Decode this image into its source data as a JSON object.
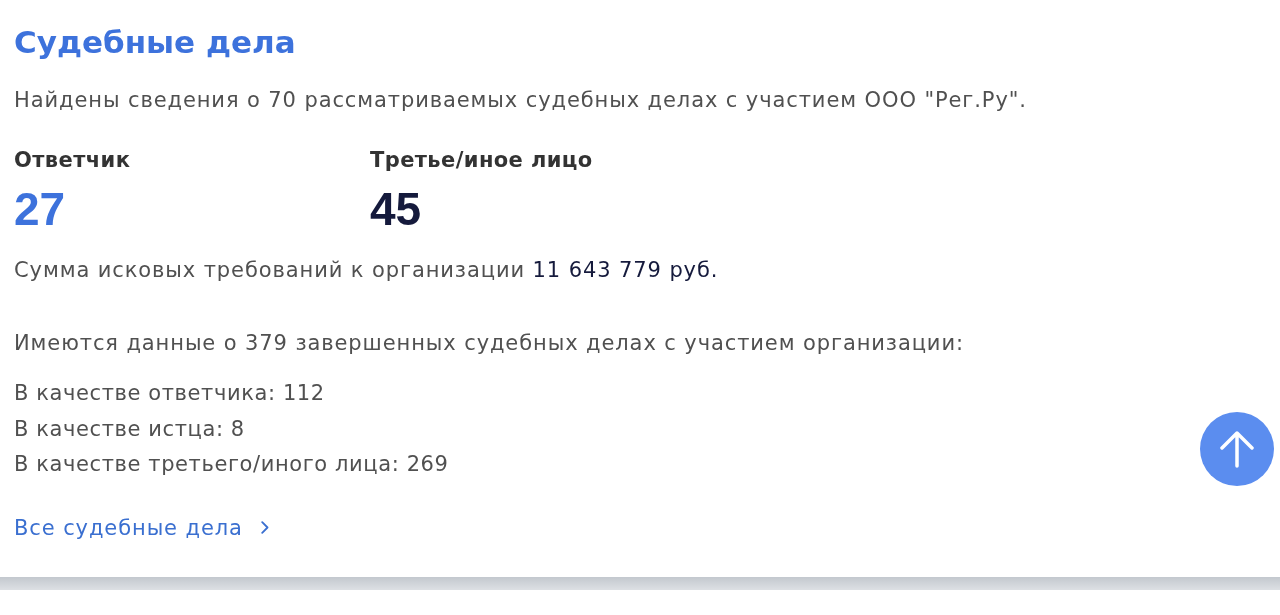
{
  "section": {
    "title": "Судебные дела",
    "summary": "Найдены сведения о 70 рассматриваемых судебных делах с участием ООО \"Рег.Ру\"."
  },
  "roles": [
    {
      "label": "Ответчик",
      "count": "27",
      "kind": "link"
    },
    {
      "label": "Третье/иное лицо",
      "count": "45",
      "kind": "plain"
    }
  ],
  "claims_total": "Сумма исковых требований к организации **11 643 779 руб.**",
  "completed": {
    "intro": "Имеются данные о 379 завершенных судебных делах с участием организации:",
    "items": [
      "В качестве ответчика: 112",
      "В качестве истца: 8",
      "В качестве третьего/иного лица: 269"
    ]
  },
  "all_cases_link": {
    "label": "Все судебные дела"
  }
}
